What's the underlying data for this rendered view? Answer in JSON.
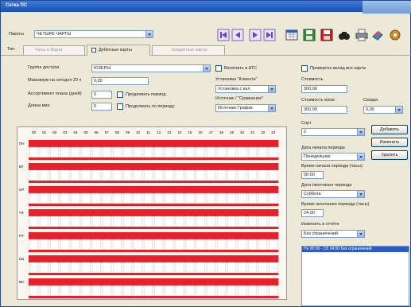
{
  "window": {
    "title": "Сетка ПС"
  },
  "toolbar": {
    "price_label": "Пакеты",
    "price_value": "ЧЕТЫРЕ  ЧАРТЫ",
    "icons": [
      "first-icon",
      "prev-icon",
      "next-icon",
      "last-icon",
      "calendar-icon",
      "save-icon",
      "delete-icon",
      "find-icon",
      "print-icon",
      "export-icon"
    ]
  },
  "tabs": {
    "label": "Тип",
    "items": [
      "Часы и Воркз",
      "Дебетные карты",
      "Кредитные карты"
    ]
  },
  "left_form": {
    "group_label": "Группа доступа",
    "group_value": "ЮЗЕРЫ",
    "max_label": "Максимум на сегодня 20 ч",
    "max_value": "0,00",
    "limit_label": "Ассортимент плана (дней)",
    "limit_value": "0",
    "limit_check_label": "Продлевать период",
    "days_label": "Длина мин",
    "days_value": "0",
    "days_check_label": "Продолжать по периоду",
    "ats_check_label": "Включить в АТС",
    "install_label": "Установка \"Клиента\"",
    "install_value": "Установка с вкл.",
    "source_label": "Источник / \"Сравнение\"",
    "source_value": "Источник График"
  },
  "right_form": {
    "sale_check_label": "Проверять вклад все карты",
    "cost_label": "Стоимость",
    "cost_value": "300,00",
    "unit_label": "Стоимость влож",
    "unit_value": "300,00",
    "discount_label": "Скидка",
    "discount_value": "0,00"
  },
  "side": {
    "card_label": "Сорт",
    "card_value": "2",
    "add_button": "Добавить",
    "change_button": "Изменить",
    "delete_button": "Удалить",
    "start_label": "Дата начала периода",
    "start_value": "Понедельник",
    "period_label": "Время начала периода (часы)",
    "period_value": "00:00",
    "end_label": "Дата окончания периода",
    "end_value": "Суббота",
    "end_time_label": "Время окончания периода (часы)",
    "end_time_value": "24:00",
    "visible_label": "Изменить в отчёте",
    "visible_value": "Без ограничений",
    "list_selected": "Пн 00:00 - Сб 24:00 Без ограничений"
  },
  "grid": {
    "hours": [
      "00",
      "01",
      "02",
      "03",
      "04",
      "05",
      "06",
      "07",
      "08",
      "09",
      "10",
      "11",
      "12",
      "13",
      "14",
      "15",
      "16",
      "17",
      "18",
      "19",
      "20",
      "21",
      "22",
      "23"
    ],
    "days": [
      "ПН",
      "ВТ",
      "СР",
      "ЧТ",
      "ПТ",
      "СБ",
      "ВС"
    ],
    "colors": {
      "band": "#e8202c",
      "cell": "#ffffff"
    }
  }
}
